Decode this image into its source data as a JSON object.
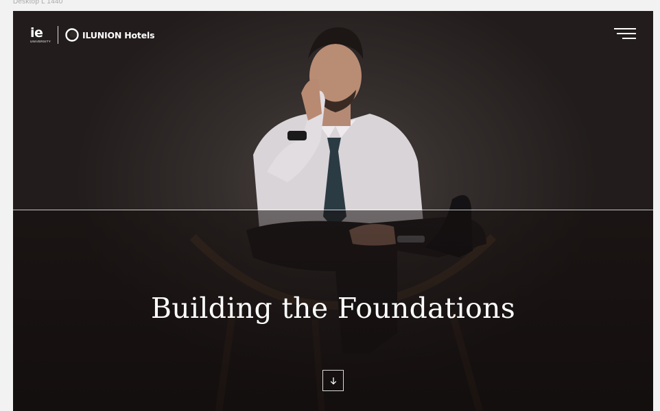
{
  "frame": {
    "label": "Desktop L 1440"
  },
  "header": {
    "logo_ie": {
      "mark": "ie",
      "sub": "UNIVERSITY"
    },
    "logo_ilunion": {
      "name": "ILUNION Hotels"
    },
    "menu_icon": "hamburger-menu-icon"
  },
  "hero": {
    "title": "Building the Foundations",
    "scroll_icon": "arrow-down-icon"
  },
  "colors": {
    "frame_background": "#f2f2f2",
    "hero_background": "#2b2524",
    "text": "#ffffff"
  }
}
